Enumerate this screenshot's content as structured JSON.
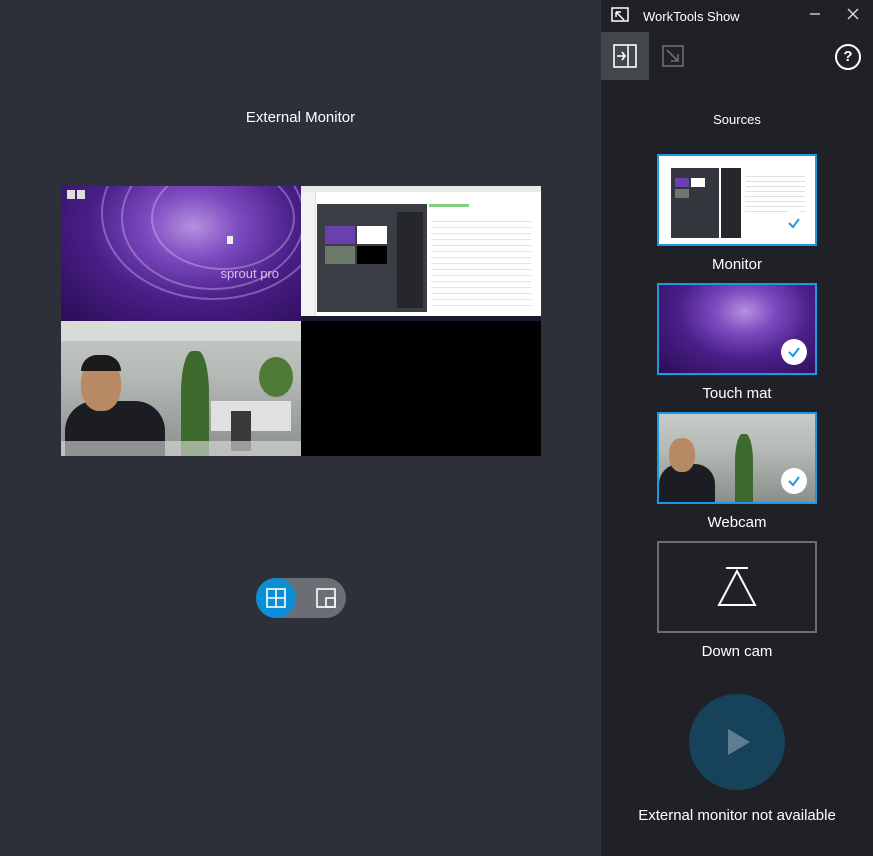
{
  "main": {
    "title": "External Monitor",
    "tiles": {
      "touchmat_watermark": "sprout pro",
      "monitor_tile": "monitor-feed",
      "webcam_tile": "webcam-feed",
      "empty_tile": "empty"
    },
    "layout_toggle": {
      "options": [
        "grid-layout",
        "picture-in-picture-layout"
      ],
      "selected": "grid-layout"
    }
  },
  "sidebar": {
    "app_title": "WorkTools Show",
    "titlebar_buttons": [
      "minimize",
      "close"
    ],
    "toolbar": {
      "tools": [
        "dock-panel",
        "undock-panel"
      ],
      "active": "dock-panel",
      "help_label": "?"
    },
    "sources_title": "Sources",
    "sources": [
      {
        "label": "Monitor",
        "selected": true
      },
      {
        "label": "Touch mat",
        "selected": true
      },
      {
        "label": "Webcam",
        "selected": true
      },
      {
        "label": "Down cam",
        "selected": false
      }
    ],
    "status": "External monitor not available"
  },
  "colors": {
    "accent": "#1a9ae0",
    "toggle_active": "#0a8fd6",
    "play_disabled": "#16425a",
    "sidebar_bg": "#1f2126",
    "main_bg": "#2d3038"
  }
}
